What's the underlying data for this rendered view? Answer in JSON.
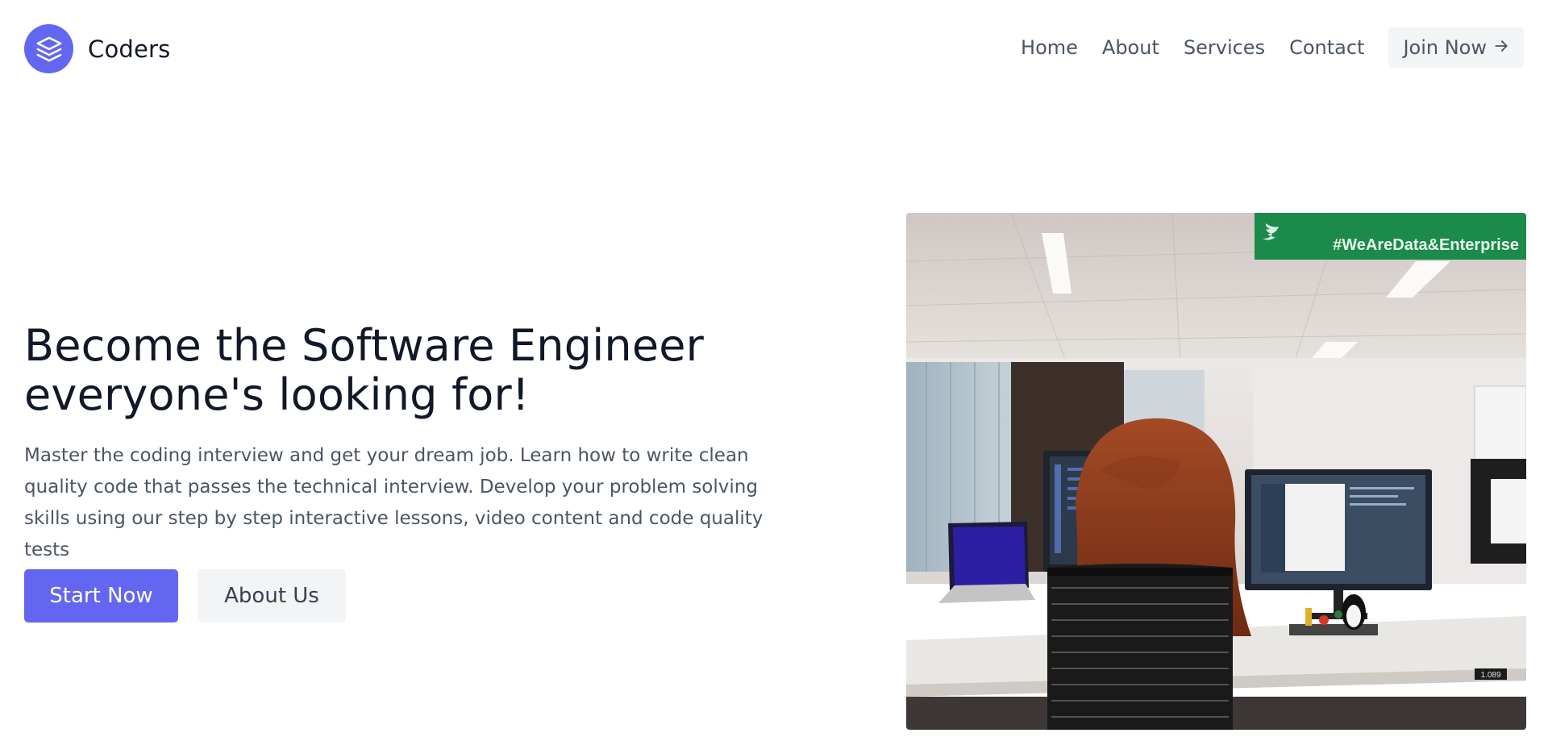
{
  "brand": {
    "name": "Coders",
    "logo_icon": "layers-icon",
    "accent_color": "#6366f1"
  },
  "nav": {
    "links": [
      "Home",
      "About",
      "Services",
      "Contact"
    ],
    "join_label": "Join Now",
    "join_icon": "arrow-right-icon"
  },
  "hero": {
    "title_line1": "Become the Software Engineer",
    "title_line2": "everyone's looking for!",
    "description": "Master the coding interview and get your dream job. Learn how to write clean quality code that passes the technical interview. Develop your problem solving skills using our step by step interactive lessons, video content and code quality tests",
    "primary_cta": "Start Now",
    "secondary_cta": "About Us"
  },
  "image": {
    "banner_text": "#WeAreData&Enterprise",
    "banner_icon": "twitter-bird-icon",
    "corner_tag": "1.089"
  }
}
